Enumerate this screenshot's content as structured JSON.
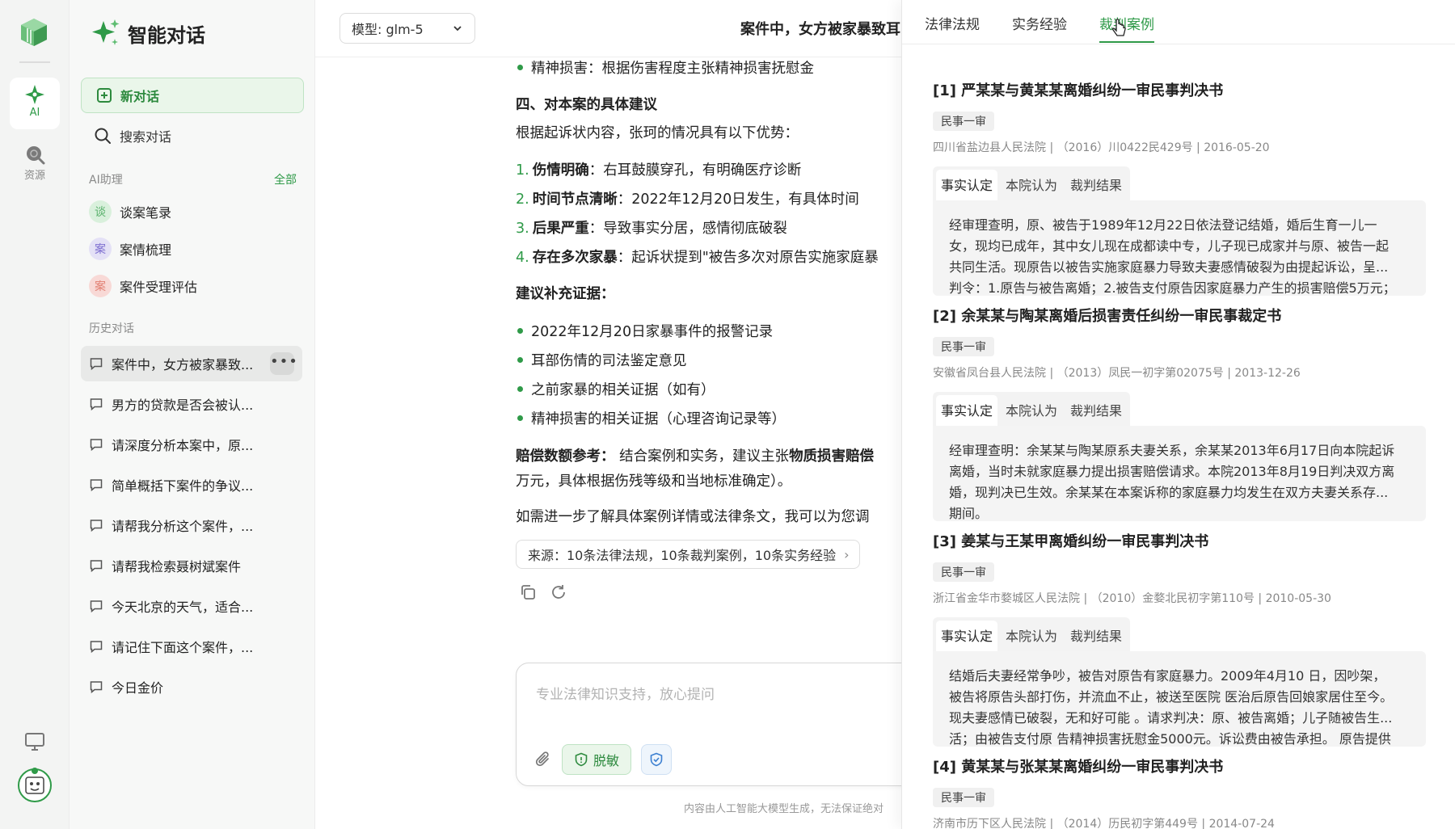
{
  "rail": {
    "items": [
      {
        "label": "AI",
        "icon": "sparkle-icon"
      },
      {
        "label": "资源",
        "icon": "search-globe-icon"
      }
    ]
  },
  "sidebar": {
    "brand_title": "智能对话",
    "new_chat": "新对话",
    "search": "搜索对话",
    "assistants_label": "AI助理",
    "assistants_all": "全部",
    "assistants": [
      {
        "avatar": "谈",
        "name": "谈案笔录"
      },
      {
        "avatar": "案",
        "name": "案情梳理"
      },
      {
        "avatar": "案",
        "name": "案件受理评估"
      }
    ],
    "history_label": "历史对话",
    "history": [
      "案件中，女方被家暴致...",
      "男方的贷款是否会被认...",
      "请深度分析本案中，原...",
      "简单概括下案件的争议...",
      "请帮我分析这个案件，...",
      "请帮我检索聂树斌案件",
      "今天北京的天气，适合...",
      "请记住下面这个案件，...",
      "今日金价"
    ]
  },
  "main": {
    "model_label": "模型: glm-5",
    "chat_title": "案件中，女方被家暴致耳",
    "lines": {
      "l1": "精神损害：根据伤害程度主张精神损害抚慰金",
      "h4": "四、对本案的具体建议",
      "intro": "根据起诉状内容，张珂的情况具有以下优势：",
      "n1_b": "伤情明确",
      "n1_t": "：右耳鼓膜穿孔，有明确医疗诊断",
      "n2_b": "时间节点清晰",
      "n2_t": "：2022年12月20日发生，有具体时间",
      "n3_b": "后果严重",
      "n3_t": "：导致事实分居，感情彻底破裂",
      "n4_b": "存在多次家暴",
      "n4_t": "：起诉状提到\"被告多次对原告实施家庭暴",
      "evidence_h": "建议补充证据：",
      "e1": "2022年12月20日家暴事件的报警记录",
      "e2": "耳部伤情的司法鉴定意见",
      "e3": "之前家暴的相关证据（如有）",
      "e4": "精神损害的相关证据（心理咨询记录等）",
      "comp_b": "赔偿数额参考：",
      "comp_t": " 结合案例和实务，建议主张",
      "comp_b2": "物质损害赔偿",
      "comp_2": "万元，具体根据伤残等级和当地标准确定）。",
      "more": "如需进一步了解具体案例详情或法律条文，我可以为您调"
    },
    "source": "来源：10条法律法规，10条裁判案例，10条实务经验",
    "input_placeholder": "专业法律知识支持，放心提问",
    "desensitize": "脱敏",
    "disclaimer": "内容由人工智能大模型生成，无法保证绝对"
  },
  "panel": {
    "tabs": [
      "法律法规",
      "实务经验",
      "裁判案例"
    ],
    "active_tab": 2,
    "case_tabs": [
      "事实认定",
      "本院认为",
      "裁判结果"
    ],
    "cases": [
      {
        "title": "[1] 严某某与黄某某离婚纠纷一审民事判决书",
        "tag": "民事一审",
        "meta": "四川省盐边县人民法院 | （2016）川0422民429号 | 2016-05-20",
        "body": [
          "经审理查明，原、被告于1989年12月22日依法登记结婚，婚后生育一儿一",
          "女，现均已成年，其中女儿现在成都读中专，儿子现已成家并与原、被告一起",
          "共同生活。现原告以被告实施家庭暴力导致夫妻感情破裂为由提起诉讼，呈...",
          "判令：1.原告与被告离婚；2.被告支付原告因家庭暴力产生的损害赔偿5万元；"
        ]
      },
      {
        "title": "[2] 余某某与陶某离婚后损害责任纠纷一审民事裁定书",
        "tag": "民事一审",
        "meta": "安徽省凤台县人民法院 | （2013）凤民一初字第02075号 | 2013-12-26",
        "body": [
          "经审理查明：余某某与陶某原系夫妻关系，余某某2013年6月17日向本院起诉",
          "离婚，当时未就家庭暴力提出损害赔偿请求。本院2013年8月19日判决双方离",
          "婚，现判决已生效。余某某在本案诉称的家庭暴力均发生在双方夫妻关系存...",
          "期间。"
        ]
      },
      {
        "title": "[3] 姜某与王某甲离婚纠纷一审民事判决书",
        "tag": "民事一审",
        "meta": "浙江省金华市婺城区人民法院 | （2010）金婺北民初字第110号 | 2010-05-30",
        "body": [
          "结婚后夫妻经常争吵，被告对原告有家庭暴力。2009年4月10 日，因吵架，",
          "被告将原告头部打伤，并流血不止，被送至医院 医治后原告回娘家居住至今。",
          "现夫妻感情已破裂，无和好可能 。请求判决：原、被告离婚；儿子随被告生...",
          "活；由被告支付原 告精神损害抚慰金5000元。诉讼费由被告承担。 原告提供"
        ]
      },
      {
        "title": "[4] 黄某某与张某某离婚纠纷一审民事判决书",
        "tag": "民事一审",
        "meta": "济南市历下区人民法院 | （2014）历民初字第449号 | 2014-07-24",
        "body": []
      }
    ]
  }
}
